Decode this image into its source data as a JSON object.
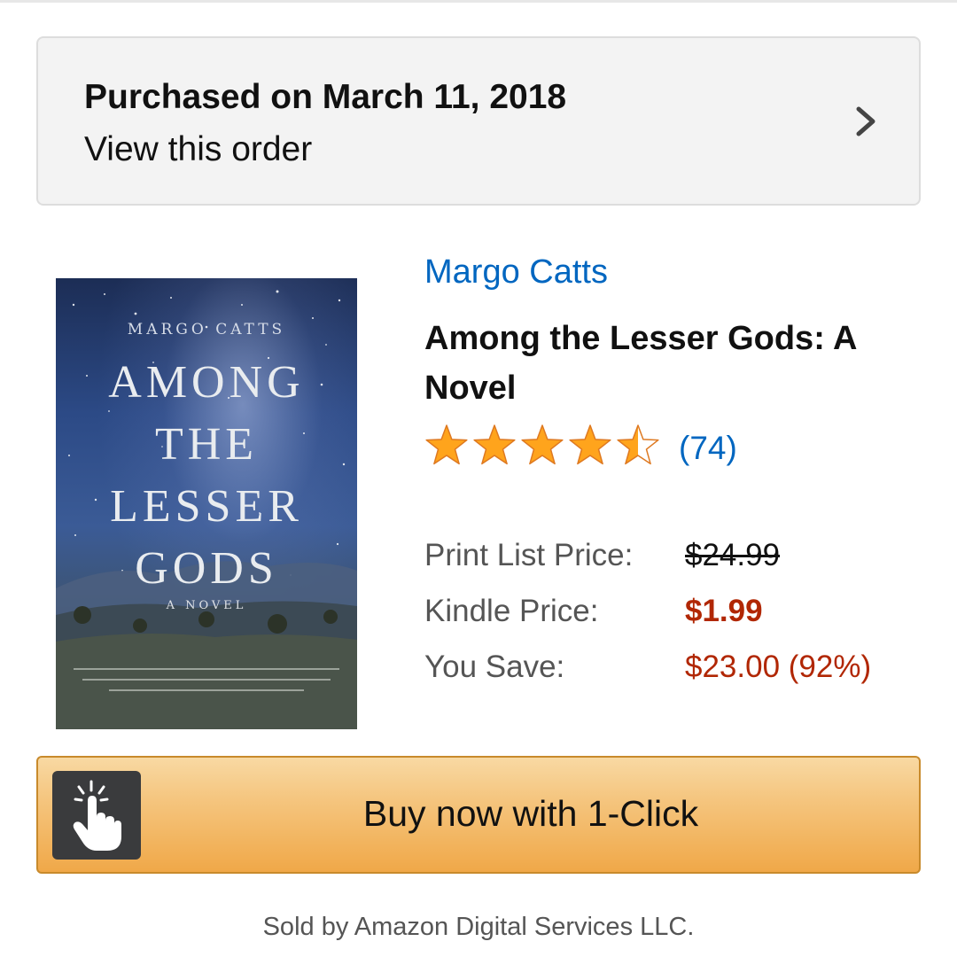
{
  "order": {
    "purchased_text": "Purchased on March 11, 2018",
    "view_label": "View this order"
  },
  "book": {
    "author": "Margo Catts",
    "title": "Among the Lesser Gods: A Novel",
    "rating_stars": 4.5,
    "rating_max": 5,
    "review_count": "(74)",
    "cover": {
      "author": "MARGO CATTS",
      "title_line1": "AMONG",
      "title_line2": "THE",
      "title_line3": "LESSER",
      "title_line4": "GODS",
      "subtitle": "A NOVEL"
    }
  },
  "pricing": {
    "list_label": "Print List Price:",
    "list_value": "$24.99",
    "kindle_label": "Kindle Price:",
    "kindle_value": "$1.99",
    "save_label": "You Save:",
    "save_value": "$23.00 (92%)"
  },
  "buy": {
    "label": "Buy now with 1-Click",
    "icon": "tap-hand-icon"
  },
  "footer": {
    "sold_by": "Sold by Amazon Digital Services LLC."
  },
  "colors": {
    "link": "#0066c0",
    "price_red": "#b12704",
    "star": "#ffa41c",
    "button_orange": "#f0a848"
  }
}
